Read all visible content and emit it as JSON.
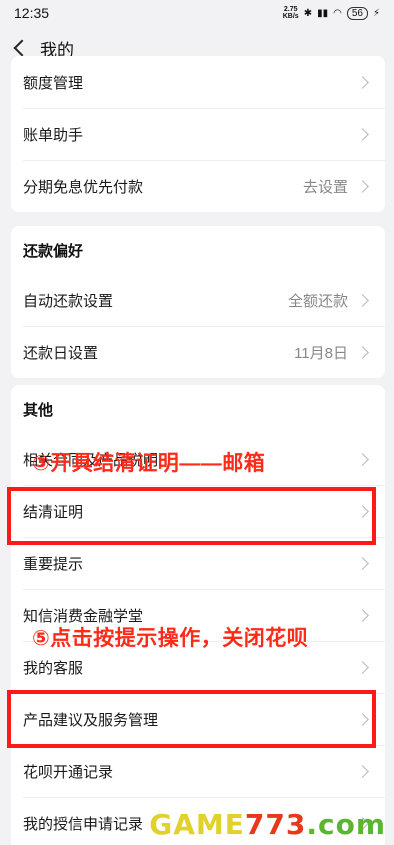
{
  "status_bar": {
    "time": "12:35",
    "net_speed_value": "2.75",
    "net_speed_unit": "KB/s",
    "battery": "56"
  },
  "nav": {
    "title": "我的"
  },
  "card1": {
    "rows": [
      {
        "label": "额度管理",
        "value": ""
      },
      {
        "label": "账单助手",
        "value": ""
      },
      {
        "label": "分期免息优先付款",
        "value": "去设置"
      }
    ]
  },
  "card2": {
    "title": "还款偏好",
    "rows": [
      {
        "label": "自动还款设置",
        "value": "全额还款"
      },
      {
        "label": "还款日设置",
        "value": "11月8日"
      }
    ]
  },
  "card3": {
    "title": "其他",
    "rows": [
      {
        "label": "相关合同及产品说明",
        "value": ""
      },
      {
        "label": "结清证明",
        "value": ""
      },
      {
        "label": "重要提示",
        "value": ""
      },
      {
        "label": "知信消费金融学堂",
        "value": ""
      },
      {
        "label": "我的客服",
        "value": ""
      },
      {
        "label": "产品建议及服务管理",
        "value": ""
      },
      {
        "label": "花呗开通记录",
        "value": ""
      },
      {
        "label": "我的授信申请记录",
        "value": ""
      }
    ]
  },
  "annotations": {
    "step3": "③开具结清证明——邮箱",
    "step5": "⑤点击按提示操作，关闭花呗"
  },
  "watermark": {
    "part1": "GAME",
    "part2": "773",
    "part3": ".com"
  },
  "colors": {
    "annotation": "#ff1a1a",
    "background": "#f2f2f4"
  }
}
